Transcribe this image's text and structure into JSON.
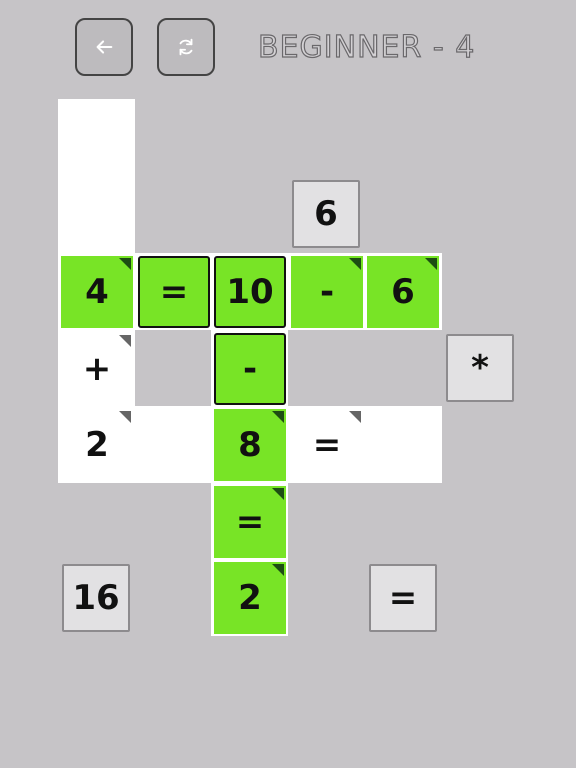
{
  "header": {
    "back_icon": "arrow-left-icon",
    "restart_icon": "refresh-icon",
    "level_title": "BEGINNER - 4"
  },
  "board": {
    "cells": {
      "r0c0": "4",
      "r0c1": "=",
      "r0c2": "10",
      "r0c3": "-",
      "r0c4": "6",
      "r1c0": "+",
      "r1c2": "-",
      "r2c0": "2",
      "r2c2": "8",
      "r2c3": "=",
      "r3c2": "=",
      "r4c2": "2"
    }
  },
  "tiles": {
    "six": "6",
    "times": "*",
    "sixteen": "16",
    "equals": "="
  },
  "colors": {
    "background": "#c6c4c7",
    "green": "#78e426",
    "corner_marker": "#1d4d13"
  }
}
